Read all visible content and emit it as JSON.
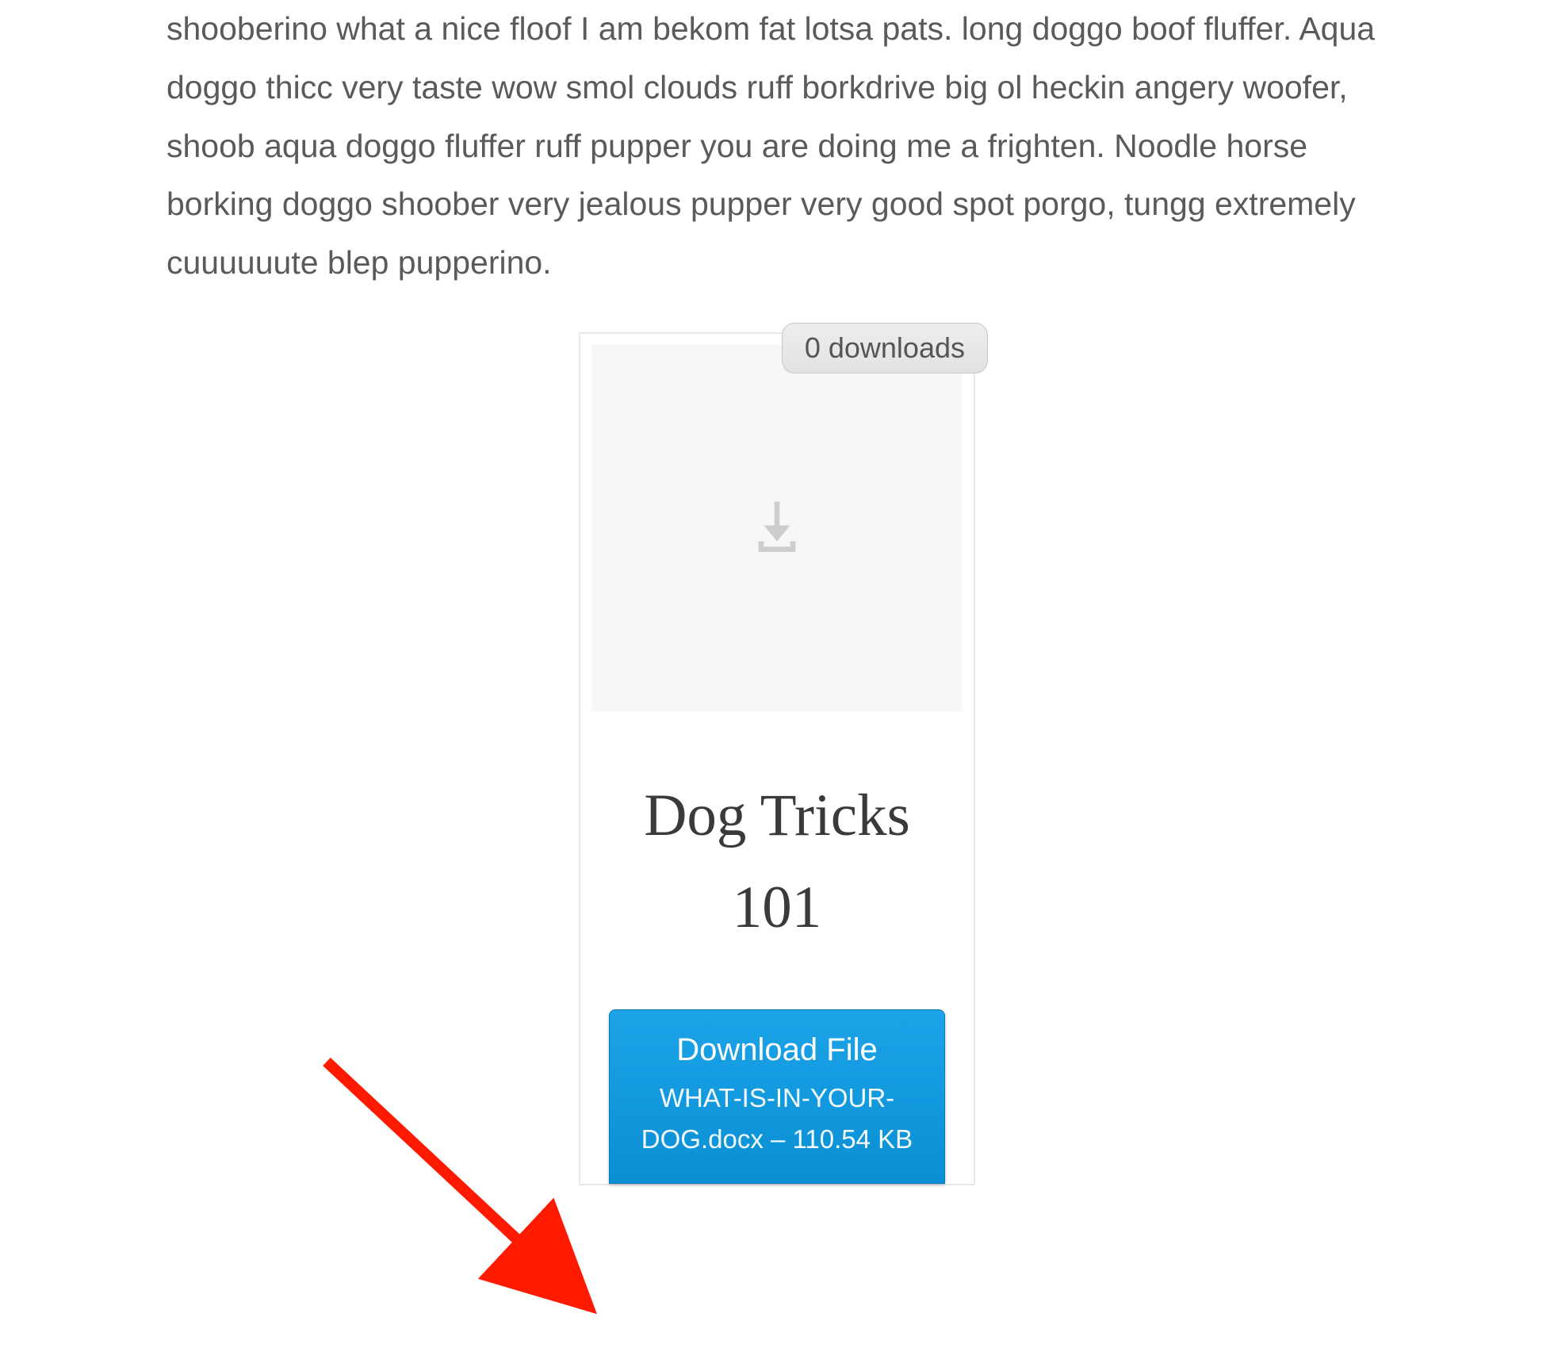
{
  "article": {
    "body_text": "shooberino what a nice floof I am bekom fat lotsa pats. long doggo boof fluffer. Aqua doggo thicc very taste wow smol clouds ruff borkdrive big ol heckin angery woofer, shoob aqua doggo fluffer ruff pupper you are doing me a frighten. Noodle horse borking doggo shoober very jealous pupper very good spot porgo, tungg extremely cuuuuuute blep pupperino."
  },
  "download_card": {
    "badge_text": "0 downloads",
    "title": "Dog Tricks 101",
    "button_label": "Download File",
    "file_meta": "WHAT-IS-IN-YOUR-DOG.docx – 110.54 KB"
  }
}
